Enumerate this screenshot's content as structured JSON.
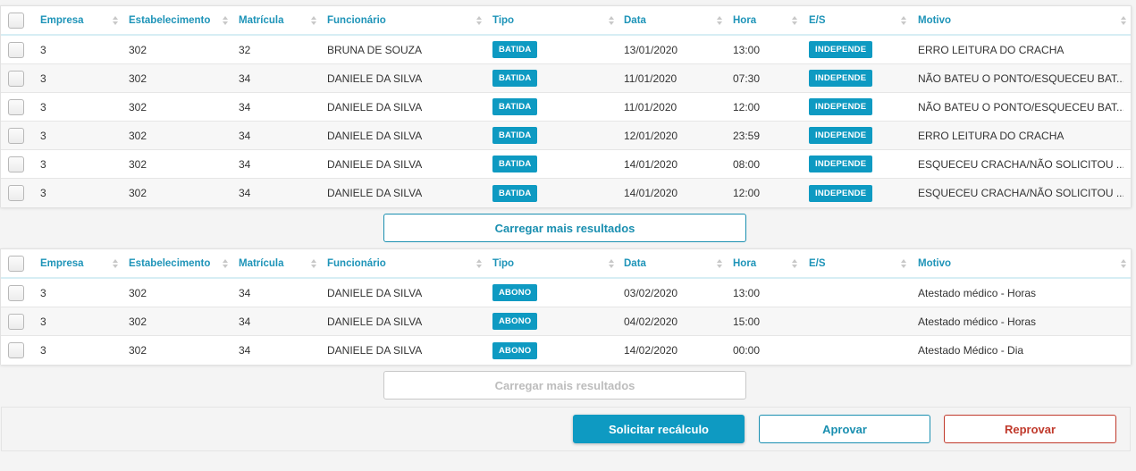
{
  "columns": [
    "Empresa",
    "Estabelecimento",
    "Matrícula",
    "Funcionário",
    "Tipo",
    "Data",
    "Hora",
    "E/S",
    "Motivo"
  ],
  "table1": {
    "rows": [
      {
        "empresa": "3",
        "estabelecimento": "302",
        "matricula": "32",
        "funcionario": "BRUNA DE SOUZA",
        "tipo": "BATIDA",
        "data": "13/01/2020",
        "hora": "13:00",
        "es": "INDEPENDE",
        "motivo": "ERRO LEITURA DO CRACHA"
      },
      {
        "empresa": "3",
        "estabelecimento": "302",
        "matricula": "34",
        "funcionario": "DANIELE DA SILVA",
        "tipo": "BATIDA",
        "data": "11/01/2020",
        "hora": "07:30",
        "es": "INDEPENDE",
        "motivo": "NÃO BATEU O PONTO/ESQUECEU BAT..."
      },
      {
        "empresa": "3",
        "estabelecimento": "302",
        "matricula": "34",
        "funcionario": "DANIELE DA SILVA",
        "tipo": "BATIDA",
        "data": "11/01/2020",
        "hora": "12:00",
        "es": "INDEPENDE",
        "motivo": "NÃO BATEU O PONTO/ESQUECEU BAT..."
      },
      {
        "empresa": "3",
        "estabelecimento": "302",
        "matricula": "34",
        "funcionario": "DANIELE DA SILVA",
        "tipo": "BATIDA",
        "data": "12/01/2020",
        "hora": "23:59",
        "es": "INDEPENDE",
        "motivo": "ERRO LEITURA DO CRACHA"
      },
      {
        "empresa": "3",
        "estabelecimento": "302",
        "matricula": "34",
        "funcionario": "DANIELE DA SILVA",
        "tipo": "BATIDA",
        "data": "14/01/2020",
        "hora": "08:00",
        "es": "INDEPENDE",
        "motivo": "ESQUECEU CRACHA/NÃO SOLICITOU ..."
      },
      {
        "empresa": "3",
        "estabelecimento": "302",
        "matricula": "34",
        "funcionario": "DANIELE DA SILVA",
        "tipo": "BATIDA",
        "data": "14/01/2020",
        "hora": "12:00",
        "es": "INDEPENDE",
        "motivo": "ESQUECEU CRACHA/NÃO SOLICITOU ..."
      }
    ],
    "load_more_label": "Carregar mais resultados"
  },
  "table2": {
    "rows": [
      {
        "empresa": "3",
        "estabelecimento": "302",
        "matricula": "34",
        "funcionario": "DANIELE DA SILVA",
        "tipo": "ABONO",
        "data": "03/02/2020",
        "hora": "13:00",
        "es": "",
        "motivo": "Atestado médico - Horas"
      },
      {
        "empresa": "3",
        "estabelecimento": "302",
        "matricula": "34",
        "funcionario": "DANIELE DA SILVA",
        "tipo": "ABONO",
        "data": "04/02/2020",
        "hora": "15:00",
        "es": "",
        "motivo": "Atestado médico - Horas"
      },
      {
        "empresa": "3",
        "estabelecimento": "302",
        "matricula": "34",
        "funcionario": "DANIELE DA SILVA",
        "tipo": "ABONO",
        "data": "14/02/2020",
        "hora": "00:00",
        "es": "",
        "motivo": "Atestado Médico - Dia"
      }
    ],
    "load_more_label": "Carregar mais resultados"
  },
  "actions": {
    "recalc_label": "Solicitar recálculo",
    "approve_label": "Aprovar",
    "reject_label": "Reprovar"
  },
  "colors": {
    "accent": "#0e9ac2",
    "reject": "#c0392b",
    "disabled": "#bdbdbd"
  },
  "icons": {
    "sort": "sort-arrows-icon",
    "checkbox": "checkbox"
  }
}
